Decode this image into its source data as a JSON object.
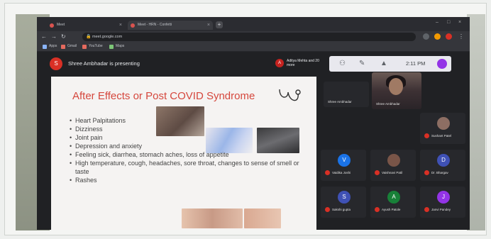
{
  "browser": {
    "tabs": [
      {
        "label": "Meet"
      },
      {
        "label": "Meet - HRN - Confetti"
      }
    ],
    "address": "meet.google.com",
    "bookmarks": [
      {
        "label": "Apps"
      },
      {
        "label": "Gmail"
      },
      {
        "label": "YouTube"
      },
      {
        "label": "Maps"
      }
    ]
  },
  "meet": {
    "presenter_initial": "S",
    "presenting_text": "Shree Ambhadar is presenting",
    "joined_initial": "A",
    "joined_text": "Aditya Mehta and 20 more",
    "time": "2:11 PM"
  },
  "slide": {
    "title": "After Effects or Post COVID Syndrome",
    "bullets": [
      "Heart Palpitations",
      "Dizziness",
      "Joint pain",
      "Depression and anxiety",
      "Feeling sick, diarrhea, stomach aches, loss of appetite",
      "High temperature, cough, headaches, sore throat, changes to sense of smell or taste",
      "Rashes"
    ]
  },
  "participants": [
    {
      "initial": "",
      "name": "Shree Ambhadar",
      "color": "#27282c"
    },
    {
      "initial": "",
      "name": "Shree Ambhadar",
      "color": "#27282c"
    },
    {
      "initial": "",
      "name": "Sushant Patel",
      "color": "#8d6e63"
    },
    {
      "initial": "V",
      "name": "Vaidika Joshi",
      "color": "#1a73e8"
    },
    {
      "initial": "",
      "name": "Vaishnavi Patil",
      "color": "#795548"
    },
    {
      "initial": "D",
      "name": "Dr. Bhargav",
      "color": "#3f51b5"
    },
    {
      "initial": "S",
      "name": "Sakshi gupta",
      "color": "#3f51b5"
    },
    {
      "initial": "A",
      "name": "Ayush Patole",
      "color": "#188038"
    },
    {
      "initial": "J",
      "name": "Janvi Pandey",
      "color": "#9334e6"
    }
  ],
  "colors": {
    "accent_red": "#d93025",
    "slide_title": "#d5473d",
    "meet_bg": "#202124"
  }
}
